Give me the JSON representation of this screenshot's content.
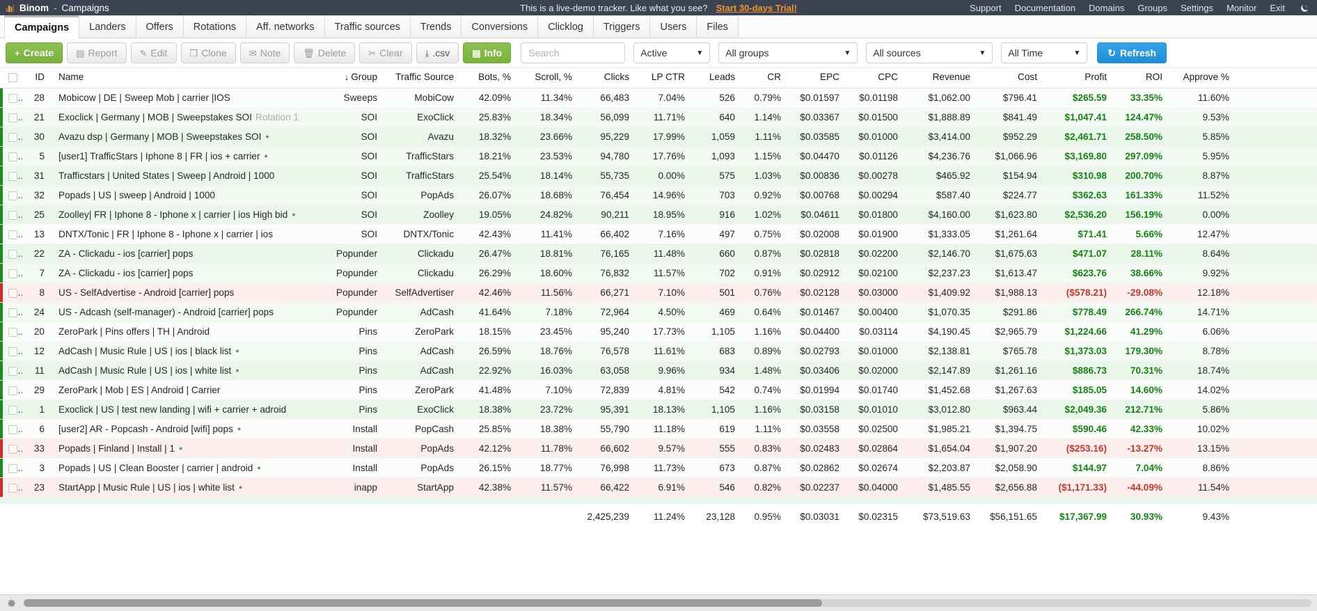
{
  "topbar": {
    "brand": "Binom",
    "separator": "-",
    "page": "Campaigns",
    "demo_message": "This is a live-demo tracker. Like what you see?",
    "trial_link": "Start 30-days Trial!",
    "nav": [
      {
        "label": "Support"
      },
      {
        "label": "Documentation"
      },
      {
        "label": "Domains"
      },
      {
        "label": "Groups"
      },
      {
        "label": "Settings"
      },
      {
        "label": "Monitor"
      },
      {
        "label": "Exit"
      }
    ],
    "theme_icon": "moon-icon"
  },
  "tabs": [
    {
      "label": "Campaigns",
      "active": true
    },
    {
      "label": "Landers",
      "active": false
    },
    {
      "label": "Offers",
      "active": false
    },
    {
      "label": "Rotations",
      "active": false
    },
    {
      "label": "Aff. networks",
      "active": false
    },
    {
      "label": "Traffic sources",
      "active": false
    },
    {
      "label": "Trends",
      "active": false
    },
    {
      "label": "Conversions",
      "active": false
    },
    {
      "label": "Clicklog",
      "active": false
    },
    {
      "label": "Triggers",
      "active": false
    },
    {
      "label": "Users",
      "active": false
    },
    {
      "label": "Files",
      "active": false
    }
  ],
  "toolbar": {
    "create": "Create",
    "report": "Report",
    "edit": "Edit",
    "clone": "Clone",
    "note": "Note",
    "delete": "Delete",
    "clear": "Clear",
    "csv": ".csv",
    "info": "Info",
    "search_placeholder": "Search",
    "search_value": "",
    "status_filter": "Active",
    "groups_filter": "All groups",
    "sources_filter": "All sources",
    "time_filter": "All Time",
    "refresh": "Refresh"
  },
  "table": {
    "sort_column": "Group",
    "sort_direction": "desc",
    "headers": {
      "id": "ID",
      "name": "Name",
      "group": "Group",
      "traffic_source": "Traffic Source",
      "bots": "Bots, %",
      "scroll": "Scroll, %",
      "clicks": "Clicks",
      "lp_ctr": "LP CTR",
      "leads": "Leads",
      "cr": "CR",
      "epc": "EPC",
      "cpc": "CPC",
      "revenue": "Revenue",
      "cost": "Cost",
      "profit": "Profit",
      "roi": "ROI",
      "approve": "Approve %"
    },
    "rows": [
      {
        "id": "28",
        "name": "Mobicow | DE | Sweep Mob | carrier |IOS",
        "note": "",
        "dot": false,
        "group": "Sweeps",
        "source": "MobiCow",
        "bots": "42.09%",
        "scroll": "11.34%",
        "clicks": "66,483",
        "lp_ctr": "7.04%",
        "leads": "526",
        "cr": "0.79%",
        "epc": "$0.01597",
        "cpc": "$0.01198",
        "revenue": "$1,062.00",
        "cost": "$796.41",
        "profit": "$265.59",
        "roi": "33.35%",
        "approve": "11.60%",
        "state": "white"
      },
      {
        "id": "21",
        "name": "Exoclick | Germany | MOB | Sweepstakes SOI",
        "note": "Rotation 1",
        "dot": false,
        "group": "SOI",
        "source": "ExoClick",
        "bots": "25.83%",
        "scroll": "18.34%",
        "clicks": "56,099",
        "lp_ctr": "11.71%",
        "leads": "640",
        "cr": "1.14%",
        "epc": "$0.03367",
        "cpc": "$0.01500",
        "revenue": "$1,888.89",
        "cost": "$841.49",
        "profit": "$1,047.41",
        "roi": "124.47%",
        "approve": "9.53%",
        "state": "green"
      },
      {
        "id": "30",
        "name": "Avazu dsp | Germany | MOB | Sweepstakes SOI",
        "note": "",
        "dot": true,
        "group": "SOI",
        "source": "Avazu",
        "bots": "18.32%",
        "scroll": "23.66%",
        "clicks": "95,229",
        "lp_ctr": "17.99%",
        "leads": "1,059",
        "cr": "1.11%",
        "epc": "$0.03585",
        "cpc": "$0.01000",
        "revenue": "$3,414.00",
        "cost": "$952.29",
        "profit": "$2,461.71",
        "roi": "258.50%",
        "approve": "5.85%",
        "state": "green"
      },
      {
        "id": "5",
        "name": "[user1] TrafficStars | Iphone 8 | FR | ios + carrier",
        "note": "",
        "dot": true,
        "group": "SOI",
        "source": "TrafficStars",
        "bots": "18.21%",
        "scroll": "23.53%",
        "clicks": "94,780",
        "lp_ctr": "17.76%",
        "leads": "1,093",
        "cr": "1.15%",
        "epc": "$0.04470",
        "cpc": "$0.01126",
        "revenue": "$4,236.76",
        "cost": "$1,066.96",
        "profit": "$3,169.80",
        "roi": "297.09%",
        "approve": "5.95%",
        "state": "green"
      },
      {
        "id": "31",
        "name": "Trafficstars | United States | Sweep | Android | 1000",
        "note": "",
        "dot": false,
        "group": "SOI",
        "source": "TrafficStars",
        "bots": "25.54%",
        "scroll": "18.14%",
        "clicks": "55,735",
        "lp_ctr": "0.00%",
        "leads": "575",
        "cr": "1.03%",
        "epc": "$0.00836",
        "cpc": "$0.00278",
        "revenue": "$465.92",
        "cost": "$154.94",
        "profit": "$310.98",
        "roi": "200.70%",
        "approve": "8.87%",
        "state": "green"
      },
      {
        "id": "32",
        "name": "Popads | US | sweep | Android | 1000",
        "note": "",
        "dot": false,
        "group": "SOI",
        "source": "PopAds",
        "bots": "26.07%",
        "scroll": "18.68%",
        "clicks": "76,454",
        "lp_ctr": "14.96%",
        "leads": "703",
        "cr": "0.92%",
        "epc": "$0.00768",
        "cpc": "$0.00294",
        "revenue": "$587.40",
        "cost": "$224.77",
        "profit": "$362.63",
        "roi": "161.33%",
        "approve": "11.52%",
        "state": "green"
      },
      {
        "id": "25",
        "name": "Zoolley| FR | Iphone 8 - Iphone x | carrier | ios High bid",
        "note": "",
        "dot": true,
        "group": "SOI",
        "source": "Zoolley",
        "bots": "19.05%",
        "scroll": "24.82%",
        "clicks": "90,211",
        "lp_ctr": "18.95%",
        "leads": "916",
        "cr": "1.02%",
        "epc": "$0.04611",
        "cpc": "$0.01800",
        "revenue": "$4,160.00",
        "cost": "$1,623.80",
        "profit": "$2,536.20",
        "roi": "156.19%",
        "approve": "0.00%",
        "state": "green"
      },
      {
        "id": "13",
        "name": "DNTX/Tonic | FR | Iphone 8 - Iphone x | carrier | ios",
        "note": "",
        "dot": false,
        "group": "SOI",
        "source": "DNTX/Tonic",
        "bots": "42.43%",
        "scroll": "11.41%",
        "clicks": "66,402",
        "lp_ctr": "7.16%",
        "leads": "497",
        "cr": "0.75%",
        "epc": "$0.02008",
        "cpc": "$0.01900",
        "revenue": "$1,333.05",
        "cost": "$1,261.64",
        "profit": "$71.41",
        "roi": "5.66%",
        "approve": "12.47%",
        "state": "white"
      },
      {
        "id": "22",
        "name": "ZA - Clickadu - ios [carrier] pops",
        "note": "",
        "dot": false,
        "group": "Popunder",
        "source": "Clickadu",
        "bots": "26.47%",
        "scroll": "18.81%",
        "clicks": "76,165",
        "lp_ctr": "11.48%",
        "leads": "660",
        "cr": "0.87%",
        "epc": "$0.02818",
        "cpc": "$0.02200",
        "revenue": "$2,146.70",
        "cost": "$1,675.63",
        "profit": "$471.07",
        "roi": "28.11%",
        "approve": "8.64%",
        "state": "green"
      },
      {
        "id": "7",
        "name": "ZA - Clickadu - ios [carrier] pops",
        "note": "",
        "dot": false,
        "group": "Popunder",
        "source": "Clickadu",
        "bots": "26.29%",
        "scroll": "18.60%",
        "clicks": "76,832",
        "lp_ctr": "11.57%",
        "leads": "702",
        "cr": "0.91%",
        "epc": "$0.02912",
        "cpc": "$0.02100",
        "revenue": "$2,237.23",
        "cost": "$1,613.47",
        "profit": "$623.76",
        "roi": "38.66%",
        "approve": "9.92%",
        "state": "green"
      },
      {
        "id": "8",
        "name": "US - SelfAdvertise - Android [carrier] pops",
        "note": "",
        "dot": false,
        "group": "Popunder",
        "source": "SelfAdvertiser",
        "bots": "42.46%",
        "scroll": "11.56%",
        "clicks": "66,271",
        "lp_ctr": "7.10%",
        "leads": "501",
        "cr": "0.76%",
        "epc": "$0.02128",
        "cpc": "$0.03000",
        "revenue": "$1,409.92",
        "cost": "$1,988.13",
        "profit": "($578.21)",
        "roi": "-29.08%",
        "approve": "12.18%",
        "state": "red"
      },
      {
        "id": "24",
        "name": "US - Adcash (self-manager) - Android [carrier] pops",
        "note": "",
        "dot": false,
        "group": "Popunder",
        "source": "AdCash",
        "bots": "41.64%",
        "scroll": "7.18%",
        "clicks": "72,964",
        "lp_ctr": "4.50%",
        "leads": "469",
        "cr": "0.64%",
        "epc": "$0.01467",
        "cpc": "$0.00400",
        "revenue": "$1,070.35",
        "cost": "$291.86",
        "profit": "$778.49",
        "roi": "266.74%",
        "approve": "14.71%",
        "state": "green"
      },
      {
        "id": "20",
        "name": "ZeroPark | Pins offers | TH | Android",
        "note": "",
        "dot": false,
        "group": "Pins",
        "source": "ZeroPark",
        "bots": "18.15%",
        "scroll": "23.45%",
        "clicks": "95,240",
        "lp_ctr": "17.73%",
        "leads": "1,105",
        "cr": "1.16%",
        "epc": "$0.04400",
        "cpc": "$0.03114",
        "revenue": "$4,190.45",
        "cost": "$2,965.79",
        "profit": "$1,224.66",
        "roi": "41.29%",
        "approve": "6.06%",
        "state": "white"
      },
      {
        "id": "12",
        "name": "AdCash | Music Rule | US | ios | black list",
        "note": "",
        "dot": true,
        "group": "Pins",
        "source": "AdCash",
        "bots": "26.59%",
        "scroll": "18.76%",
        "clicks": "76,578",
        "lp_ctr": "11.61%",
        "leads": "683",
        "cr": "0.89%",
        "epc": "$0.02793",
        "cpc": "$0.01000",
        "revenue": "$2,138.81",
        "cost": "$765.78",
        "profit": "$1,373.03",
        "roi": "179.30%",
        "approve": "8.78%",
        "state": "green"
      },
      {
        "id": "11",
        "name": "AdCash | Music Rule | US | ios | white list",
        "note": "",
        "dot": true,
        "group": "Pins",
        "source": "AdCash",
        "bots": "22.92%",
        "scroll": "16.03%",
        "clicks": "63,058",
        "lp_ctr": "9.96%",
        "leads": "934",
        "cr": "1.48%",
        "epc": "$0.03406",
        "cpc": "$0.02000",
        "revenue": "$2,147.89",
        "cost": "$1,261.16",
        "profit": "$886.73",
        "roi": "70.31%",
        "approve": "18.74%",
        "state": "green"
      },
      {
        "id": "29",
        "name": "ZeroPark | Mob | ES | Android | Carrier",
        "note": "",
        "dot": false,
        "group": "Pins",
        "source": "ZeroPark",
        "bots": "41.48%",
        "scroll": "7.10%",
        "clicks": "72,839",
        "lp_ctr": "4.81%",
        "leads": "542",
        "cr": "0.74%",
        "epc": "$0.01994",
        "cpc": "$0.01740",
        "revenue": "$1,452.68",
        "cost": "$1,267.63",
        "profit": "$185.05",
        "roi": "14.60%",
        "approve": "14.02%",
        "state": "white"
      },
      {
        "id": "1",
        "name": "Exoclick | US | test new landing | wifi + carrier + adroid",
        "note": "",
        "dot": false,
        "group": "Pins",
        "source": "ExoClick",
        "bots": "18.38%",
        "scroll": "23.72%",
        "clicks": "95,391",
        "lp_ctr": "18.13%",
        "leads": "1,105",
        "cr": "1.16%",
        "epc": "$0.03158",
        "cpc": "$0.01010",
        "revenue": "$3,012.80",
        "cost": "$963.44",
        "profit": "$2,049.36",
        "roi": "212.71%",
        "approve": "5.86%",
        "state": "green"
      },
      {
        "id": "6",
        "name": "[user2] AR - Popcash - Android [wifi] pops",
        "note": "",
        "dot": true,
        "group": "Install",
        "source": "PopCash",
        "bots": "25.85%",
        "scroll": "18.38%",
        "clicks": "55,790",
        "lp_ctr": "11.18%",
        "leads": "619",
        "cr": "1.11%",
        "epc": "$0.03558",
        "cpc": "$0.02500",
        "revenue": "$1,985.21",
        "cost": "$1,394.75",
        "profit": "$590.46",
        "roi": "42.33%",
        "approve": "10.02%",
        "state": "white"
      },
      {
        "id": "33",
        "name": "Popads | Finland | Install | 1",
        "note": "",
        "dot": true,
        "group": "Install",
        "source": "PopAds",
        "bots": "42.12%",
        "scroll": "11.78%",
        "clicks": "66,602",
        "lp_ctr": "9.57%",
        "leads": "555",
        "cr": "0.83%",
        "epc": "$0.02483",
        "cpc": "$0.02864",
        "revenue": "$1,654.04",
        "cost": "$1,907.20",
        "profit": "($253.16)",
        "roi": "-13.27%",
        "approve": "13.15%",
        "state": "red"
      },
      {
        "id": "3",
        "name": "Popads | US | Clean Booster | carrier | android",
        "note": "",
        "dot": true,
        "group": "Install",
        "source": "PopAds",
        "bots": "26.15%",
        "scroll": "18.77%",
        "clicks": "76,998",
        "lp_ctr": "11.73%",
        "leads": "673",
        "cr": "0.87%",
        "epc": "$0.02862",
        "cpc": "$0.02674",
        "revenue": "$2,203.87",
        "cost": "$2,058.90",
        "profit": "$144.97",
        "roi": "7.04%",
        "approve": "8.86%",
        "state": "white"
      },
      {
        "id": "23",
        "name": "StartApp | Music Rule | US | ios | white list",
        "note": "",
        "dot": true,
        "group": "inapp",
        "source": "StartApp",
        "bots": "42.38%",
        "scroll": "11.57%",
        "clicks": "66,422",
        "lp_ctr": "6.91%",
        "leads": "546",
        "cr": "0.82%",
        "epc": "$0.02237",
        "cpc": "$0.04000",
        "revenue": "$1,485.55",
        "cost": "$2,656.88",
        "profit": "($1,171.33)",
        "roi": "-44.09%",
        "approve": "11.54%",
        "state": "red"
      }
    ],
    "totals": {
      "id": "",
      "name": "",
      "group": "",
      "source": "",
      "bots": "",
      "scroll": "",
      "clicks": "2,425,239",
      "lp_ctr": "11.24%",
      "leads": "23,128",
      "cr": "0.95%",
      "epc": "$0.03031",
      "cpc": "$0.02315",
      "revenue": "$73,519.63",
      "cost": "$56,151.65",
      "profit": "$17,367.99",
      "roi": "30.93%",
      "approve": "9.43%"
    }
  },
  "statusbar": {
    "settings_icon": "gear-icon",
    "scrollbar": "horizontal-scrollbar"
  }
}
